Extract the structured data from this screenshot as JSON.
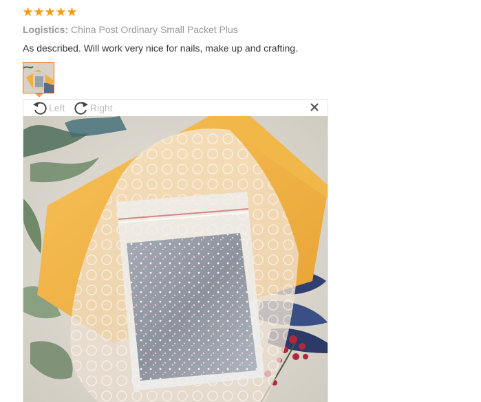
{
  "review": {
    "rating_stars": 5,
    "star_color": "#f39c12",
    "logistics_label": "Logistics:",
    "logistics_value": "China Post Ordinary Small Packet Plus",
    "text": "As described. Will work very nice for nails, make up and crafting."
  },
  "viewer": {
    "rotate_left_label": "Left",
    "rotate_right_label": "Right",
    "close_icon": "close-icon",
    "rotate_left_icon": "rotate-left-icon",
    "rotate_right_icon": "rotate-right-icon"
  },
  "colors": {
    "accent": "#ff6a00",
    "muted_text": "#999999",
    "body_text": "#333333"
  }
}
